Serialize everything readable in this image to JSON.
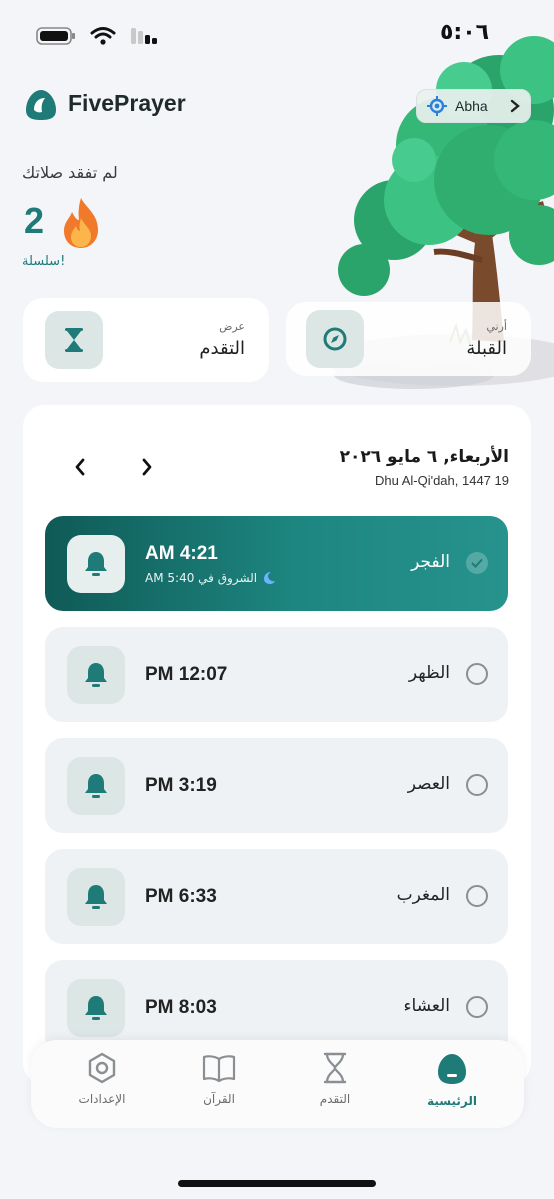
{
  "status_bar": {
    "time": "٥:٠٦"
  },
  "header": {
    "app_name": "FivePrayer",
    "location": "Abha"
  },
  "streak": {
    "title": "لم تفقد صلاتك",
    "count": "2",
    "label": "!سلسلة"
  },
  "actions": {
    "progress": {
      "sub": "عرض",
      "main": "التقدم"
    },
    "qibla": {
      "sub": "أرني",
      "main": "القبلة"
    }
  },
  "schedule": {
    "date_gregorian": "الأربعاء, ٦ مايو ٢٠٢٦",
    "date_hijri": "Dhu Al-Qi'dah, 1447 19",
    "prayers": [
      {
        "name": "الفجر",
        "time": "AM 4:21",
        "sunrise": "الشروق في 5:40 AM",
        "active": true,
        "done": true
      },
      {
        "name": "الظهر",
        "time": "PM 12:07",
        "active": false,
        "done": false
      },
      {
        "name": "العصر",
        "time": "PM 3:19",
        "active": false,
        "done": false
      },
      {
        "name": "المغرب",
        "time": "PM 6:33",
        "active": false,
        "done": false
      },
      {
        "name": "العشاء",
        "time": "PM 8:03",
        "active": false,
        "done": false
      }
    ]
  },
  "tabs": [
    {
      "label": "الإعدادات",
      "icon": "settings-icon",
      "active": false
    },
    {
      "label": "القرآن",
      "icon": "book-icon",
      "active": false
    },
    {
      "label": "التقدم",
      "icon": "hourglass-icon",
      "active": false
    },
    {
      "label": "الرئيسية",
      "icon": "home-icon",
      "active": true
    }
  ],
  "colors": {
    "accent": "#1f7b78",
    "active_start": "#0f5a57",
    "active_end": "#26938c"
  }
}
